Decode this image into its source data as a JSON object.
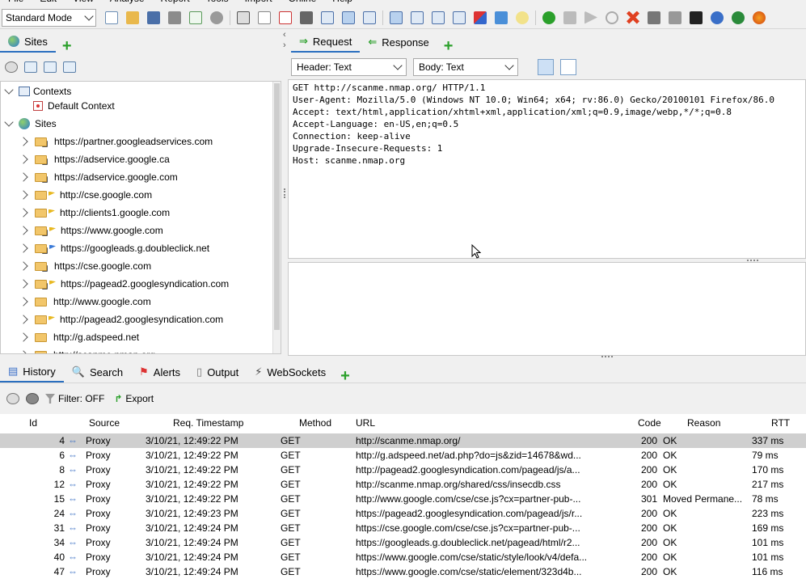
{
  "menu": [
    "File",
    "Edit",
    "View",
    "Analyse",
    "Report",
    "Tools",
    "Import",
    "Online",
    "Help"
  ],
  "mode_select": "Standard Mode",
  "left_tabs": {
    "sites": "Sites"
  },
  "tree": {
    "contexts": "Contexts",
    "default_context": "Default Context",
    "sites": "Sites",
    "items": [
      {
        "label": "https://partner.googleadservices.com",
        "icon": "lock",
        "flag": ""
      },
      {
        "label": "https://adservice.google.ca",
        "icon": "lock",
        "flag": ""
      },
      {
        "label": "https://adservice.google.com",
        "icon": "lock",
        "flag": ""
      },
      {
        "label": "http://cse.google.com",
        "icon": "folder",
        "flag": "yellow"
      },
      {
        "label": "http://clients1.google.com",
        "icon": "folder",
        "flag": "yellow"
      },
      {
        "label": "https://www.google.com",
        "icon": "lock",
        "flag": "yellow"
      },
      {
        "label": "https://googleads.g.doubleclick.net",
        "icon": "lock",
        "flag": "blue"
      },
      {
        "label": "https://cse.google.com",
        "icon": "lock",
        "flag": ""
      },
      {
        "label": "https://pagead2.googlesyndication.com",
        "icon": "lock",
        "flag": "yellow"
      },
      {
        "label": "http://www.google.com",
        "icon": "folder",
        "flag": ""
      },
      {
        "label": "http://pagead2.googlesyndication.com",
        "icon": "folder",
        "flag": "yellow"
      },
      {
        "label": "http://g.adspeed.net",
        "icon": "folder",
        "flag": ""
      },
      {
        "label": "http://scanme.nmap.org",
        "icon": "folder",
        "flag": ""
      }
    ]
  },
  "right_tabs": {
    "request": "Request",
    "response": "Response"
  },
  "header_select": "Header: Text",
  "body_select": "Body: Text",
  "request_text": [
    "GET http://scanme.nmap.org/ HTTP/1.1",
    "User-Agent: Mozilla/5.0 (Windows NT 10.0; Win64; x64; rv:86.0) Gecko/20100101 Firefox/86.0",
    "Accept: text/html,application/xhtml+xml,application/xml;q=0.9,image/webp,*/*;q=0.8",
    "Accept-Language: en-US,en;q=0.5",
    "Connection: keep-alive",
    "Upgrade-Insecure-Requests: 1",
    "Host: scanme.nmap.org"
  ],
  "bottom_tabs": [
    "History",
    "Search",
    "Alerts",
    "Output",
    "WebSockets"
  ],
  "filter_label": "Filter: OFF",
  "export_label": "Export",
  "columns": [
    "Id",
    "Source",
    "Req. Timestamp",
    "Method",
    "URL",
    "Code",
    "Reason",
    "RTT"
  ],
  "rows": [
    {
      "id": "4",
      "source": "Proxy",
      "ts": "3/10/21, 12:49:22 PM",
      "method": "GET",
      "url": "http://scanme.nmap.org/",
      "code": "200",
      "reason": "OK",
      "rtt": "337 ms"
    },
    {
      "id": "6",
      "source": "Proxy",
      "ts": "3/10/21, 12:49:22 PM",
      "method": "GET",
      "url": "http://g.adspeed.net/ad.php?do=js&zid=14678&wd...",
      "code": "200",
      "reason": "OK",
      "rtt": "79 ms"
    },
    {
      "id": "8",
      "source": "Proxy",
      "ts": "3/10/21, 12:49:22 PM",
      "method": "GET",
      "url": "http://pagead2.googlesyndication.com/pagead/js/a...",
      "code": "200",
      "reason": "OK",
      "rtt": "170 ms"
    },
    {
      "id": "12",
      "source": "Proxy",
      "ts": "3/10/21, 12:49:22 PM",
      "method": "GET",
      "url": "http://scanme.nmap.org/shared/css/insecdb.css",
      "code": "200",
      "reason": "OK",
      "rtt": "217 ms"
    },
    {
      "id": "15",
      "source": "Proxy",
      "ts": "3/10/21, 12:49:22 PM",
      "method": "GET",
      "url": "http://www.google.com/cse/cse.js?cx=partner-pub-...",
      "code": "301",
      "reason": "Moved Permane...",
      "rtt": "78 ms"
    },
    {
      "id": "24",
      "source": "Proxy",
      "ts": "3/10/21, 12:49:23 PM",
      "method": "GET",
      "url": "https://pagead2.googlesyndication.com/pagead/js/r...",
      "code": "200",
      "reason": "OK",
      "rtt": "223 ms"
    },
    {
      "id": "31",
      "source": "Proxy",
      "ts": "3/10/21, 12:49:24 PM",
      "method": "GET",
      "url": "https://cse.google.com/cse/cse.js?cx=partner-pub-...",
      "code": "200",
      "reason": "OK",
      "rtt": "169 ms"
    },
    {
      "id": "34",
      "source": "Proxy",
      "ts": "3/10/21, 12:49:24 PM",
      "method": "GET",
      "url": "https://googleads.g.doubleclick.net/pagead/html/r2...",
      "code": "200",
      "reason": "OK",
      "rtt": "101 ms"
    },
    {
      "id": "40",
      "source": "Proxy",
      "ts": "3/10/21, 12:49:24 PM",
      "method": "GET",
      "url": "https://www.google.com/cse/static/style/look/v4/defa...",
      "code": "200",
      "reason": "OK",
      "rtt": "101 ms"
    },
    {
      "id": "47",
      "source": "Proxy",
      "ts": "3/10/21, 12:49:24 PM",
      "method": "GET",
      "url": "https://www.google.com/cse/static/element/323d4b...",
      "code": "200",
      "reason": "OK",
      "rtt": "116 ms"
    }
  ],
  "colors": {
    "accent": "#2a6fbf",
    "selected_row": "#cfcfcf",
    "plus": "#2ba02b"
  }
}
